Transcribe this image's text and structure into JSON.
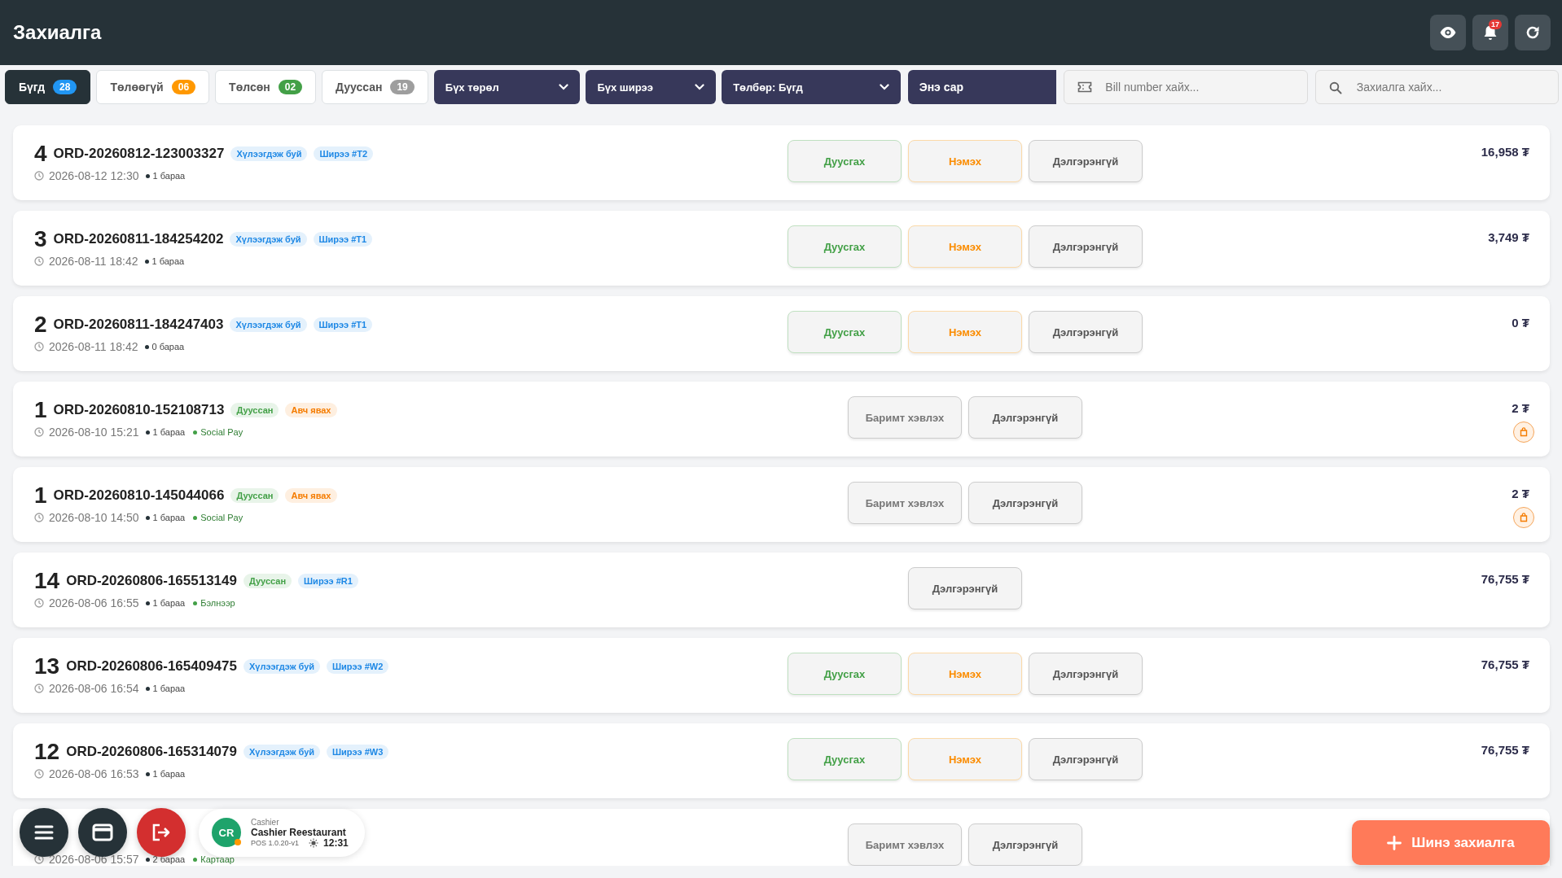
{
  "header": {
    "title": "Захиалга",
    "notification_count": "17"
  },
  "status_tabs": [
    {
      "label": "Бүгд",
      "count": "28",
      "color": "#2196f3",
      "selected": true
    },
    {
      "label": "Төлөөгүй",
      "count": "06",
      "color": "#ff9800",
      "selected": false
    },
    {
      "label": "Төлсөн",
      "count": "02",
      "color": "#43a047",
      "selected": false
    },
    {
      "label": "Дууссан",
      "count": "19",
      "color": "#9e9e9e",
      "selected": false
    }
  ],
  "filters": [
    {
      "label": "Бүх төрөл",
      "kind": "dropdown"
    },
    {
      "label": "Бүх ширээ",
      "kind": "dropdown"
    },
    {
      "label": "Төлбөр: Бүгд",
      "kind": "dropdown"
    },
    {
      "label": "Энэ сар",
      "kind": "date"
    }
  ],
  "bill_search": {
    "placeholder": "Bill number хайх..."
  },
  "order_search": {
    "placeholder": "Захиалга хайх..."
  },
  "orders": [
    {
      "number": "4",
      "order_id": "ORD-20260812-123003327",
      "tags": [
        {
          "label": "Хүлээгдэж буй",
          "color": "#1e88e5"
        },
        {
          "label": "Ширээ #T2",
          "color": "#1e88e5"
        }
      ],
      "date": "2026-08-12 12:30",
      "items": "1 бараа",
      "actions": [
        {
          "kind": "finish",
          "label": "Дуусгах"
        },
        {
          "kind": "add",
          "label": "Нэмэх"
        },
        {
          "kind": "details",
          "label": "Дэлгэрэнгүй"
        }
      ],
      "amount": "16,958 ₮",
      "takeaway": false
    },
    {
      "number": "3",
      "order_id": "ORD-20260811-184254202",
      "tags": [
        {
          "label": "Хүлээгдэж буй",
          "color": "#1e88e5"
        },
        {
          "label": "Ширээ #T1",
          "color": "#1e88e5"
        }
      ],
      "date": "2026-08-11 18:42",
      "items": "1 бараа",
      "actions": [
        {
          "kind": "finish",
          "label": "Дуусгах"
        },
        {
          "kind": "add",
          "label": "Нэмэх"
        },
        {
          "kind": "details",
          "label": "Дэлгэрэнгүй"
        }
      ],
      "amount": "3,749 ₮",
      "takeaway": false
    },
    {
      "number": "2",
      "order_id": "ORD-20260811-184247403",
      "tags": [
        {
          "label": "Хүлээгдэж буй",
          "color": "#1e88e5"
        },
        {
          "label": "Ширээ #T1",
          "color": "#1e88e5"
        }
      ],
      "date": "2026-08-11 18:42",
      "items": "0 бараа",
      "actions": [
        {
          "kind": "finish",
          "label": "Дуусгах"
        },
        {
          "kind": "add",
          "label": "Нэмэх"
        },
        {
          "kind": "details",
          "label": "Дэлгэрэнгүй"
        }
      ],
      "amount": "0 ₮",
      "takeaway": false
    },
    {
      "number": "1",
      "order_id": "ORD-20260810-152108713",
      "tags": [
        {
          "label": "Дууссан",
          "color": "#43a047"
        },
        {
          "label": "Авч явах",
          "color": "#f57c00"
        }
      ],
      "date": "2026-08-10 15:21",
      "items": "1 бараа",
      "payment": "Social Pay",
      "actions": [
        {
          "kind": "receipt",
          "label": "Баримт хэвлэх"
        },
        {
          "kind": "details",
          "label": "Дэлгэрэнгүй"
        }
      ],
      "amount": "2 ₮",
      "takeaway": true
    },
    {
      "number": "1",
      "order_id": "ORD-20260810-145044066",
      "tags": [
        {
          "label": "Дууссан",
          "color": "#43a047"
        },
        {
          "label": "Авч явах",
          "color": "#f57c00"
        }
      ],
      "date": "2026-08-10 14:50",
      "items": "1 бараа",
      "payment": "Social Pay",
      "actions": [
        {
          "kind": "receipt",
          "label": "Баримт хэвлэх"
        },
        {
          "kind": "details",
          "label": "Дэлгэрэнгүй"
        }
      ],
      "amount": "2 ₮",
      "takeaway": true
    },
    {
      "number": "14",
      "order_id": "ORD-20260806-165513149",
      "tags": [
        {
          "label": "Дууссан",
          "color": "#43a047"
        },
        {
          "label": "Ширээ #R1",
          "color": "#1e88e5"
        }
      ],
      "date": "2026-08-06 16:55",
      "items": "1 бараа",
      "payment": "Бэлнээр",
      "actions": [
        {
          "kind": "details",
          "label": "Дэлгэрэнгүй"
        }
      ],
      "amount": "76,755 ₮",
      "takeaway": false
    },
    {
      "number": "13",
      "order_id": "ORD-20260806-165409475",
      "tags": [
        {
          "label": "Хүлээгдэж буй",
          "color": "#1e88e5"
        },
        {
          "label": "Ширээ #W2",
          "color": "#1e88e5"
        }
      ],
      "date": "2026-08-06 16:54",
      "items": "1 бараа",
      "actions": [
        {
          "kind": "finish",
          "label": "Дуусгах"
        },
        {
          "kind": "add",
          "label": "Нэмэх"
        },
        {
          "kind": "details",
          "label": "Дэлгэрэнгүй"
        }
      ],
      "amount": "76,755 ₮",
      "takeaway": false
    },
    {
      "number": "12",
      "order_id": "ORD-20260806-165314079",
      "tags": [
        {
          "label": "Хүлээгдэж буй",
          "color": "#1e88e5"
        },
        {
          "label": "Ширээ #W3",
          "color": "#1e88e5"
        }
      ],
      "date": "2026-08-06 16:53",
      "items": "1 бараа",
      "actions": [
        {
          "kind": "finish",
          "label": "Дуусгах"
        },
        {
          "kind": "add",
          "label": "Нэмэх"
        },
        {
          "kind": "details",
          "label": "Дэлгэрэнгүй"
        }
      ],
      "amount": "76,755 ₮",
      "takeaway": false
    },
    {
      "date": "2026-08-06 15:57",
      "items": "2 бараа",
      "payment": "Картаар",
      "actions": [
        {
          "kind": "receipt",
          "label": "Баримт хэвлэх"
        },
        {
          "kind": "details",
          "label": "Дэлгэрэнгүй"
        }
      ],
      "takeaway": false
    }
  ],
  "user": {
    "initials": "CR",
    "role": "Cashier",
    "name": "Cashier Reestaurant",
    "version": "POS 1.0.20-v1",
    "time": "12:31"
  },
  "new_order_button": "Шинэ захиалга"
}
